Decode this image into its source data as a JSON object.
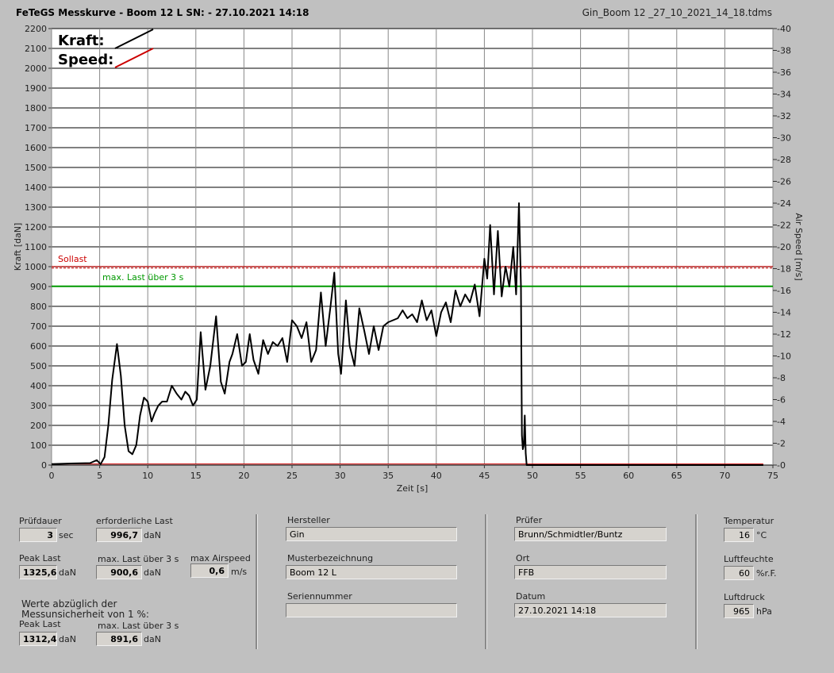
{
  "header": {
    "title": "FeTeGS Messkurve - Boom 12 L  SN:  - 27.10.2021 14:18",
    "file": "Gin_Boom 12 _27_10_2021_14_18.tdms"
  },
  "legend": {
    "kraft": "Kraft:",
    "speed": "Speed:"
  },
  "chart_data": {
    "type": "line",
    "xlabel": "Zeit [s]",
    "ylabel": "Kraft [daN]",
    "y2label": "Air Speed [m/s]",
    "xlim": [
      0,
      75
    ],
    "ylim": [
      0,
      2200
    ],
    "y2lim": [
      0,
      40
    ],
    "xticks": [
      "0",
      "5",
      "10",
      "15",
      "20",
      "25",
      "30",
      "35",
      "40",
      "45",
      "50",
      "55",
      "60",
      "65",
      "70",
      "75"
    ],
    "yticks": [
      "0",
      "100",
      "200",
      "300",
      "400",
      "500",
      "600",
      "700",
      "800",
      "900",
      "1000",
      "1100",
      "1200",
      "1300",
      "1400",
      "1500",
      "1600",
      "1700",
      "1800",
      "1900",
      "2000",
      "2100",
      "2200"
    ],
    "y2ticks": [
      "0",
      "2",
      "4",
      "6",
      "8",
      "10",
      "12",
      "14",
      "16",
      "18",
      "20",
      "22",
      "24",
      "26",
      "28",
      "30",
      "32",
      "34",
      "36",
      "38",
      "40"
    ],
    "grid": true,
    "legend_position": "top-left",
    "colors": {
      "kraft": "#000000",
      "speed": "#cc0000",
      "sollast": "#cc0000",
      "maxlast": "#009900"
    },
    "reference_lines": [
      {
        "name": "Sollast",
        "y": 997
      },
      {
        "name": "max. Last über  3 s",
        "y": 901
      }
    ],
    "series": [
      {
        "name": "Kraft",
        "x": [
          0,
          2,
          4,
          4.7,
          5.1,
          5.5,
          5.9,
          6.3,
          6.8,
          7.2,
          7.6,
          8,
          8.4,
          8.8,
          9.2,
          9.6,
          10,
          10.4,
          10.7,
          11.1,
          11.5,
          12,
          12.5,
          13,
          13.5,
          13.9,
          14.3,
          14.7,
          15.1,
          15.5,
          16,
          16.5,
          17.1,
          17.6,
          18,
          18.5,
          18.8,
          19.3,
          19.8,
          20.2,
          20.6,
          21,
          21.5,
          22,
          22.5,
          23,
          23.5,
          24,
          24.5,
          25,
          25.5,
          26,
          26.5,
          27,
          27.5,
          28,
          28.5,
          29,
          29.4,
          29.8,
          30.1,
          30.6,
          31,
          31.5,
          32,
          32.5,
          33,
          33.5,
          34,
          34.5,
          35,
          35.5,
          36,
          36.5,
          37,
          37.5,
          38,
          38.5,
          39,
          39.5,
          40,
          40.5,
          41,
          41.5,
          42,
          42.5,
          43,
          43.5,
          44,
          44.5,
          45,
          45.3,
          45.6,
          46,
          46.4,
          46.8,
          47.2,
          47.6,
          48,
          48.3,
          48.6,
          48.8,
          48.9,
          49,
          49.1,
          49.2,
          49.3,
          49.4,
          49.5,
          49.6,
          49.7,
          49.8,
          50,
          55,
          60,
          65,
          70,
          74
        ],
        "values": [
          5,
          8,
          10,
          25,
          5,
          40,
          200,
          430,
          610,
          450,
          200,
          70,
          55,
          100,
          250,
          340,
          320,
          220,
          260,
          300,
          320,
          320,
          400,
          360,
          330,
          370,
          350,
          300,
          330,
          670,
          380,
          500,
          750,
          420,
          360,
          520,
          560,
          660,
          500,
          520,
          660,
          530,
          460,
          630,
          560,
          620,
          600,
          640,
          520,
          730,
          700,
          640,
          720,
          520,
          580,
          870,
          600,
          800,
          970,
          560,
          460,
          830,
          600,
          500,
          790,
          680,
          560,
          700,
          580,
          700,
          720,
          730,
          740,
          780,
          740,
          760,
          720,
          830,
          730,
          780,
          650,
          770,
          820,
          720,
          880,
          800,
          860,
          820,
          910,
          750,
          1040,
          940,
          1210,
          860,
          1180,
          850,
          1000,
          900,
          1100,
          860,
          1320,
          900,
          150,
          80,
          100,
          250,
          60,
          0,
          0,
          0,
          0,
          0,
          0,
          0,
          0,
          0,
          0,
          0
        ]
      },
      {
        "name": "Speed",
        "x": [
          0,
          74
        ],
        "values": [
          0.1,
          0.1
        ]
      }
    ]
  },
  "fields": {
    "pruefdauer": {
      "label": "Prüfdauer",
      "value": "3",
      "unit": "sec"
    },
    "erforderliche_last": {
      "label": "erforderliche Last",
      "value": "996,7",
      "unit": "daN"
    },
    "peak_last": {
      "label": "Peak Last",
      "value": "1325,6",
      "unit": "daN"
    },
    "max_last": {
      "label": "max. Last über  3 s",
      "value": "900,6",
      "unit": "daN"
    },
    "max_airspeed": {
      "label": "max Airspeed",
      "value": "0,6",
      "unit": "m/s"
    },
    "werte_note_1": "Werte abzüglich der",
    "werte_note_2": "Messunsicherheit von 1  %:",
    "peak_last_2": {
      "label": "Peak Last",
      "value": "1312,4",
      "unit": "daN"
    },
    "max_last_2": {
      "label": "max. Last über  3 s",
      "value": "891,6",
      "unit": "daN"
    },
    "hersteller": {
      "label": "Hersteller",
      "value": "Gin"
    },
    "musterbezeichnung": {
      "label": "Musterbezeichnung",
      "value": "Boom 12 L"
    },
    "seriennummer": {
      "label": "Seriennummer",
      "value": ""
    },
    "pruefer": {
      "label": "Prüfer",
      "value": "Brunn/Schmidtler/Buntz"
    },
    "ort": {
      "label": "Ort",
      "value": "FFB"
    },
    "datum": {
      "label": "Datum",
      "value": "27.10.2021 14:18"
    },
    "temperatur": {
      "label": "Temperatur",
      "value": "16",
      "unit": "°C"
    },
    "luftfeuchte": {
      "label": "Luftfeuchte",
      "value": "60",
      "unit": "%r.F."
    },
    "luftdruck": {
      "label": "Luftdruck",
      "value": "965",
      "unit": "hPa"
    }
  }
}
